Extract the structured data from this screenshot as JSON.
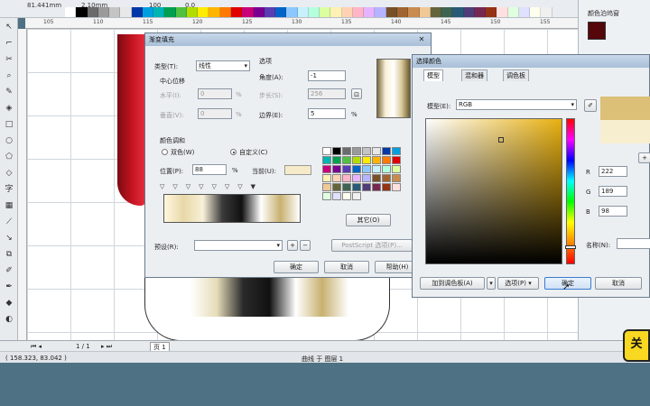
{
  "topbar": {
    "coord_a": "81.441mm",
    "coord_b": "2.10mm",
    "zoom": "100",
    "rotation": "0.0"
  },
  "ruler_ticks": [
    "105",
    "110",
    "115",
    "120",
    "125",
    "130",
    "135",
    "140",
    "145",
    "150",
    "155"
  ],
  "palette_colors": [
    "#ffffff",
    "#000000",
    "#6b6b6b",
    "#9a9a9a",
    "#c4c4c4",
    "#e8e8e8",
    "#0038a8",
    "#00a0e0",
    "#00b4b4",
    "#00a050",
    "#50c040",
    "#b4dc00",
    "#ffec00",
    "#ffb400",
    "#ff7800",
    "#e00000",
    "#c8007a",
    "#7a0090",
    "#5a3cb4",
    "#0064c8",
    "#8cc8ff",
    "#c8f0ff",
    "#b4ffdc",
    "#dcffa0",
    "#fff0b4",
    "#ffd2b4",
    "#ffb4c8",
    "#e6b4ff",
    "#b4b4ff",
    "#785028",
    "#a06432",
    "#c88c50",
    "#f0c896",
    "#64643c",
    "#3c6450",
    "#285a78",
    "#503c78",
    "#782850",
    "#963214",
    "#ffe0e0",
    "#e0ffe0",
    "#e0e0ff",
    "#fffff0",
    "#f0f0f0"
  ],
  "docker": {
    "title": "颜色泊坞窗"
  },
  "status": {
    "coords": "( 158.323, 83.042 )",
    "info": "曲线 于 图层 1",
    "page": "1 / 1",
    "page_tab": "页 1"
  },
  "gradient_dialog": {
    "title": "渐变填充",
    "type_label": "类型(T):",
    "type_value": "线性",
    "center_label": "中心位移",
    "h_label": "水平(I):",
    "h_value": "0",
    "h_unit": "%",
    "v_label": "垂直(V):",
    "v_value": "0",
    "v_unit": "%",
    "options_label": "选项",
    "angle_label": "角度(A):",
    "angle_value": "-1",
    "steps_label": "步长(S):",
    "steps_value": "256",
    "edge_label": "边界(E):",
    "edge_value": "5",
    "edge_unit": "%",
    "blend_label": "颜色调和",
    "two_color": "双色(W)",
    "custom": "自定义(C)",
    "pos_label": "位置(P):",
    "pos_value": "88",
    "pos_unit": "%",
    "current_label": "当前(U):",
    "other_btn": "其它(O)",
    "preset_label": "预设(R):",
    "postscript_btn": "PostScript 选项(P)...",
    "ok": "确定",
    "cancel": "取消",
    "help": "帮助(H)",
    "current_color": "#f6ebc8"
  },
  "color_dialog": {
    "title": "选择颜色",
    "tabs": [
      "模型",
      "混和器",
      "调色板"
    ],
    "model_label": "模型(E):",
    "model_value": "RGB",
    "r_label": "R",
    "r_value": "222",
    "g_label": "G",
    "g_value": "189",
    "b_label": "B",
    "b_value": "98",
    "name_label": "名称(N):",
    "add_palette": "加到调色板(A)",
    "options": "选项(P)",
    "ok": "确定",
    "cancel": "取消",
    "swatch_new": "#dcc078",
    "swatch_old": "#f7eed0"
  },
  "badge_text": "关"
}
